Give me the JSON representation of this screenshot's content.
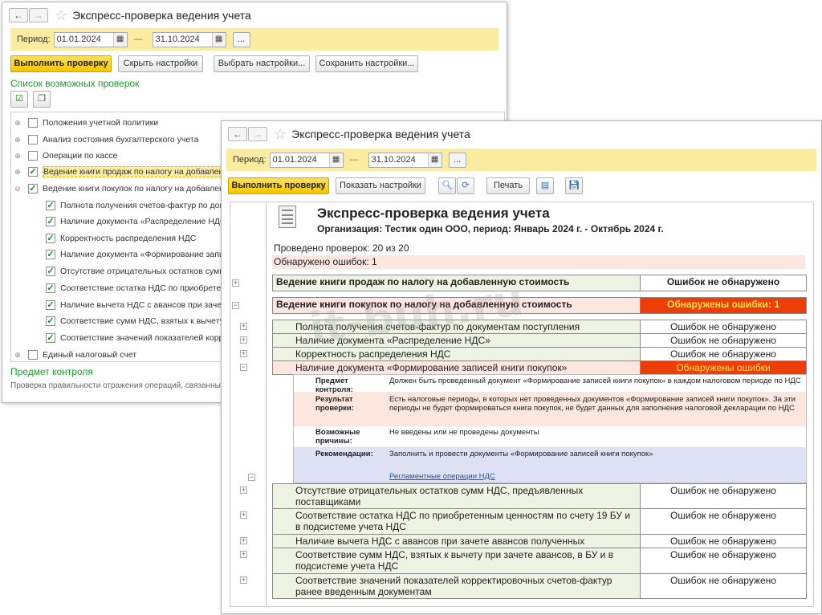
{
  "w1": {
    "title": "Экспресс-проверка ведения учета",
    "period_label": "Период:",
    "date_from": "01.01.2024",
    "date_to": "31.10.2024",
    "btn_run": "Выполнить проверку",
    "btn_hide": "Скрыть настройки",
    "btn_choose": "Выбрать настройки...",
    "btn_save": "Сохранить настройки...",
    "list_title": "Список возможных проверок",
    "items": [
      {
        "label": "Положения учетной политики",
        "checked": false,
        "exp": "⊕"
      },
      {
        "label": "Анализ состояния бухгалтерского учета",
        "checked": false,
        "exp": "⊕"
      },
      {
        "label": "Операции по кассе",
        "checked": false,
        "exp": "⊕"
      },
      {
        "label": "Ведение книги продаж по налогу на добавленную стоимость",
        "checked": true,
        "exp": "⊕"
      },
      {
        "label": "Ведение книги покупок по налогу на добавленную стоимость",
        "checked": true,
        "exp": "⊖"
      },
      {
        "label": "Полнота получения счетов-фактур по документам поступления",
        "checked": true,
        "exp": ""
      },
      {
        "label": "Наличие документа «Распределение НДС»",
        "checked": true,
        "exp": ""
      },
      {
        "label": "Корректность распределения НДС",
        "checked": true,
        "exp": ""
      },
      {
        "label": "Наличие документа «Формирование записей книги покупок»",
        "checked": true,
        "exp": ""
      },
      {
        "label": "Отсутствие отрицательных остатков сумм НДС, предъявленных поставщиками",
        "checked": true,
        "exp": ""
      },
      {
        "label": "Соответствие остатка НДС по приобретенным ценностям",
        "checked": true,
        "exp": ""
      },
      {
        "label": "Наличие вычета НДС с авансов при зачете авансов полученных",
        "checked": true,
        "exp": ""
      },
      {
        "label": "Соответствие сумм НДС, взятых к вычету при зачете авансов",
        "checked": true,
        "exp": ""
      },
      {
        "label": "Соответствие значений показателей корректировочных счетов-фактур",
        "checked": true,
        "exp": ""
      },
      {
        "label": "Единый налоговый счет",
        "checked": false,
        "exp": "⊕"
      }
    ],
    "subject_title": "Предмет контроля",
    "subject_text": "Проверка правильности отражения операций, связанных с НДС"
  },
  "w2": {
    "title": "Экспресс-проверка ведения учета",
    "period_label": "Период:",
    "date_from": "01.01.2024",
    "date_to": "31.10.2024",
    "btn_run": "Выполнить проверку",
    "btn_show": "Показать настройки",
    "btn_print": "Печать",
    "report": {
      "title": "Экспресс-проверка ведения учета",
      "org": "Организация: Тестик один ООО, период: Январь 2024 г. - Октябрь 2024 г.",
      "done": "Проведено проверок: 20 из 20",
      "errors": "Обнаружено ошибок: 1",
      "sec1": {
        "label": "Ведение книги продаж по налогу на добавленную стоимость",
        "status": "Ошибок не обнаружено"
      },
      "sec2": {
        "label": "Ведение книги покупок по налогу на добавленную стоимость",
        "status": "Обнаружены ошибки: 1"
      },
      "rows_a": [
        {
          "label": "Полнота получения счетов-фактур по документам поступления",
          "status": "Ошибок не обнаружено"
        },
        {
          "label": "Наличие документа «Распределение НДС»",
          "status": "Ошибок не обнаружено"
        },
        {
          "label": "Корректность распределения НДС",
          "status": "Ошибок не обнаружено"
        },
        {
          "label": "Наличие документа «Формирование записей книги покупок»",
          "status": "Обнаружены ошибки"
        }
      ],
      "detail": {
        "k1": "Предмет контроля:",
        "v1": "Должен быть проведенный документ «Формирование записей книги покупок» в каждом налоговом периоде по НДС",
        "k2": "Результат проверки:",
        "v2": "Есть налоговые периоды, в которых нет проведенных документов «Формирование записей книги покупок». За эти периоды не будет формироваться книга покупок, не будет данных для заполнения налоговой декларации по НДС",
        "k3": "Возможные причины:",
        "v3": "Не введены или не проведены документы",
        "k4": "Рекомендации:",
        "v4": "Заполнить и провести документы «Формирование записей книги покупок»",
        "link": "Регламентные операции НДС"
      },
      "rows_b": [
        {
          "label": "Отсутствие отрицательных остатков сумм НДС, предъявленных поставщиками",
          "status": "Ошибок не обнаружено"
        },
        {
          "label": "Соответствие остатка НДС по приобретенным ценностям по счету 19 БУ и в подсистеме учета НДС",
          "status": "Ошибок не обнаружено"
        },
        {
          "label": "Наличие вычета НДС с авансов при зачете авансов полученных",
          "status": "Ошибок не обнаружено"
        },
        {
          "label": "Соответствие сумм НДС, взятых к вычету при зачете авансов, в БУ и в подсистеме учета НДС",
          "status": "Ошибок не обнаружено"
        },
        {
          "label": "Соответствие значений показателей корректировочных счетов-фактур ранее введенным документам",
          "status": "Ошибок не обнаружено"
        }
      ]
    }
  },
  "watermark": "it-buh.ru"
}
